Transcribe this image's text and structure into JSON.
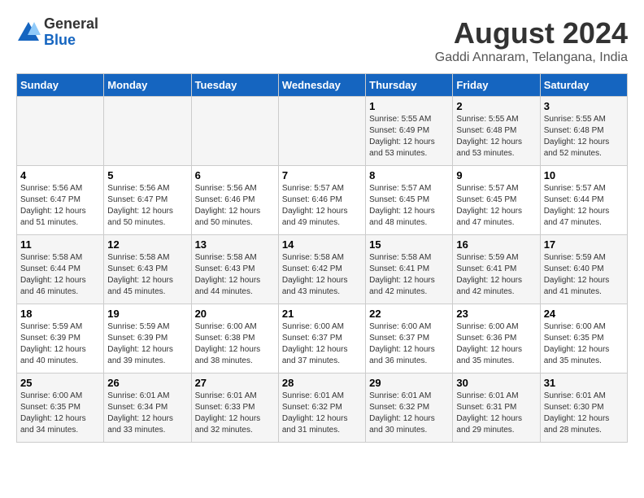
{
  "logo": {
    "general": "General",
    "blue": "Blue"
  },
  "title": "August 2024",
  "subtitle": "Gaddi Annaram, Telangana, India",
  "weekdays": [
    "Sunday",
    "Monday",
    "Tuesday",
    "Wednesday",
    "Thursday",
    "Friday",
    "Saturday"
  ],
  "weeks": [
    [
      {
        "day": "",
        "info": ""
      },
      {
        "day": "",
        "info": ""
      },
      {
        "day": "",
        "info": ""
      },
      {
        "day": "",
        "info": ""
      },
      {
        "day": "1",
        "info": "Sunrise: 5:55 AM\nSunset: 6:49 PM\nDaylight: 12 hours\nand 53 minutes."
      },
      {
        "day": "2",
        "info": "Sunrise: 5:55 AM\nSunset: 6:48 PM\nDaylight: 12 hours\nand 53 minutes."
      },
      {
        "day": "3",
        "info": "Sunrise: 5:55 AM\nSunset: 6:48 PM\nDaylight: 12 hours\nand 52 minutes."
      }
    ],
    [
      {
        "day": "4",
        "info": "Sunrise: 5:56 AM\nSunset: 6:47 PM\nDaylight: 12 hours\nand 51 minutes."
      },
      {
        "day": "5",
        "info": "Sunrise: 5:56 AM\nSunset: 6:47 PM\nDaylight: 12 hours\nand 50 minutes."
      },
      {
        "day": "6",
        "info": "Sunrise: 5:56 AM\nSunset: 6:46 PM\nDaylight: 12 hours\nand 50 minutes."
      },
      {
        "day": "7",
        "info": "Sunrise: 5:57 AM\nSunset: 6:46 PM\nDaylight: 12 hours\nand 49 minutes."
      },
      {
        "day": "8",
        "info": "Sunrise: 5:57 AM\nSunset: 6:45 PM\nDaylight: 12 hours\nand 48 minutes."
      },
      {
        "day": "9",
        "info": "Sunrise: 5:57 AM\nSunset: 6:45 PM\nDaylight: 12 hours\nand 47 minutes."
      },
      {
        "day": "10",
        "info": "Sunrise: 5:57 AM\nSunset: 6:44 PM\nDaylight: 12 hours\nand 47 minutes."
      }
    ],
    [
      {
        "day": "11",
        "info": "Sunrise: 5:58 AM\nSunset: 6:44 PM\nDaylight: 12 hours\nand 46 minutes."
      },
      {
        "day": "12",
        "info": "Sunrise: 5:58 AM\nSunset: 6:43 PM\nDaylight: 12 hours\nand 45 minutes."
      },
      {
        "day": "13",
        "info": "Sunrise: 5:58 AM\nSunset: 6:43 PM\nDaylight: 12 hours\nand 44 minutes."
      },
      {
        "day": "14",
        "info": "Sunrise: 5:58 AM\nSunset: 6:42 PM\nDaylight: 12 hours\nand 43 minutes."
      },
      {
        "day": "15",
        "info": "Sunrise: 5:58 AM\nSunset: 6:41 PM\nDaylight: 12 hours\nand 42 minutes."
      },
      {
        "day": "16",
        "info": "Sunrise: 5:59 AM\nSunset: 6:41 PM\nDaylight: 12 hours\nand 42 minutes."
      },
      {
        "day": "17",
        "info": "Sunrise: 5:59 AM\nSunset: 6:40 PM\nDaylight: 12 hours\nand 41 minutes."
      }
    ],
    [
      {
        "day": "18",
        "info": "Sunrise: 5:59 AM\nSunset: 6:39 PM\nDaylight: 12 hours\nand 40 minutes."
      },
      {
        "day": "19",
        "info": "Sunrise: 5:59 AM\nSunset: 6:39 PM\nDaylight: 12 hours\nand 39 minutes."
      },
      {
        "day": "20",
        "info": "Sunrise: 6:00 AM\nSunset: 6:38 PM\nDaylight: 12 hours\nand 38 minutes."
      },
      {
        "day": "21",
        "info": "Sunrise: 6:00 AM\nSunset: 6:37 PM\nDaylight: 12 hours\nand 37 minutes."
      },
      {
        "day": "22",
        "info": "Sunrise: 6:00 AM\nSunset: 6:37 PM\nDaylight: 12 hours\nand 36 minutes."
      },
      {
        "day": "23",
        "info": "Sunrise: 6:00 AM\nSunset: 6:36 PM\nDaylight: 12 hours\nand 35 minutes."
      },
      {
        "day": "24",
        "info": "Sunrise: 6:00 AM\nSunset: 6:35 PM\nDaylight: 12 hours\nand 35 minutes."
      }
    ],
    [
      {
        "day": "25",
        "info": "Sunrise: 6:00 AM\nSunset: 6:35 PM\nDaylight: 12 hours\nand 34 minutes."
      },
      {
        "day": "26",
        "info": "Sunrise: 6:01 AM\nSunset: 6:34 PM\nDaylight: 12 hours\nand 33 minutes."
      },
      {
        "day": "27",
        "info": "Sunrise: 6:01 AM\nSunset: 6:33 PM\nDaylight: 12 hours\nand 32 minutes."
      },
      {
        "day": "28",
        "info": "Sunrise: 6:01 AM\nSunset: 6:32 PM\nDaylight: 12 hours\nand 31 minutes."
      },
      {
        "day": "29",
        "info": "Sunrise: 6:01 AM\nSunset: 6:32 PM\nDaylight: 12 hours\nand 30 minutes."
      },
      {
        "day": "30",
        "info": "Sunrise: 6:01 AM\nSunset: 6:31 PM\nDaylight: 12 hours\nand 29 minutes."
      },
      {
        "day": "31",
        "info": "Sunrise: 6:01 AM\nSunset: 6:30 PM\nDaylight: 12 hours\nand 28 minutes."
      }
    ]
  ]
}
